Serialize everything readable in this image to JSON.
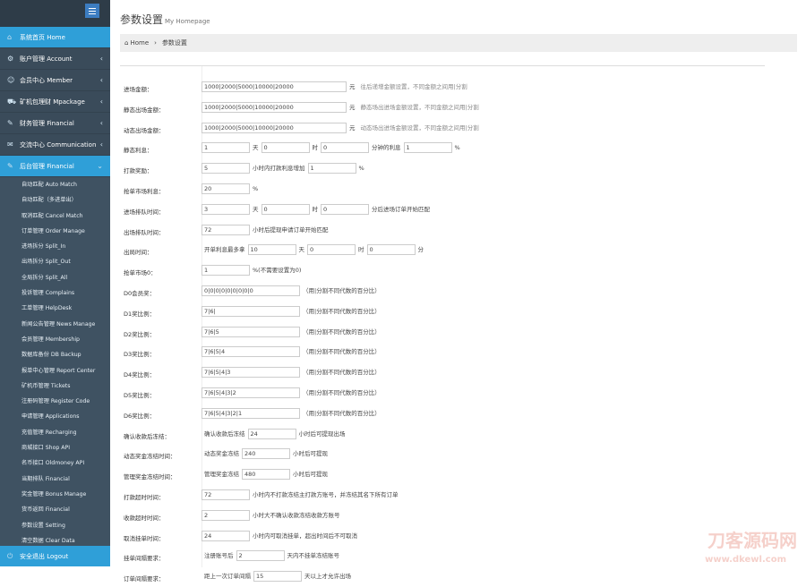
{
  "sidebar": {
    "items": [
      {
        "label": "系统首页 Home",
        "icon": "home-icon",
        "state": "active",
        "chev": ""
      },
      {
        "label": "账户管理 Account",
        "icon": "gear-icon",
        "state": "",
        "chev": "‹"
      },
      {
        "label": "会员中心 Member",
        "icon": "user-icon",
        "state": "",
        "chev": "‹"
      },
      {
        "label": "矿机包理财 Mpackage",
        "icon": "cart-icon",
        "state": "",
        "chev": "‹"
      },
      {
        "label": "财务管理 Financial",
        "icon": "tag-icon",
        "state": "",
        "chev": "‹"
      },
      {
        "label": "交流中心 Communication",
        "icon": "chat-icon",
        "state": "",
        "chev": "‹"
      },
      {
        "label": "后台管理 Financial",
        "icon": "tag-icon",
        "state": "open",
        "chev": "⌄"
      }
    ],
    "subitems": [
      "自动匹配 Auto Match",
      "自动匹配（多进单出）",
      "取消匹配 Cancel Match",
      "订单管理 Order Manage",
      "进场拆分 Split_In",
      "出场拆分 Split_Out",
      "全局拆分 Split_All",
      "投诉管理 Complains",
      "工单管理 HelpDesk",
      "新闻公告管理 News Manage",
      "会员管理 Membership",
      "数据库备份 DB Backup",
      "报单中心管理 Report Center",
      "矿机币管理 Tickets",
      "注册码管理 Register Code",
      "申请管理 Applications",
      "充值管理 Recharging",
      "商城接口 Shop API",
      "名币接口 Oldmoney API",
      "当期排队 Financial",
      "奖金管理 Bonus Manage",
      "货币返回 Financial",
      "参数设置 Setting",
      "清空数据 Clear Data"
    ],
    "logout": "安全退出 Logout"
  },
  "header": {
    "title": "参数设置",
    "subtitle": "My Homepage"
  },
  "breadcrumb": {
    "home": "Home",
    "sep": "›",
    "current": "参数设置"
  },
  "watermark": {
    "main": "刀客源码网",
    "url": "www.dkewl.com"
  },
  "form": {
    "rows": [
      {
        "label": "进场金额：",
        "parts": [
          {
            "t": "inp",
            "v": "1000|2000|5000|10000|20000",
            "w": 156
          },
          {
            "t": "txt",
            "v": "元"
          },
          {
            "t": "note",
            "v": "往后递增金额设置，不同金额之间用|分割"
          }
        ]
      },
      {
        "label": "静态出场金额：",
        "parts": [
          {
            "t": "inp",
            "v": "1000|2000|5000|10000|20000",
            "w": 156
          },
          {
            "t": "txt",
            "v": "元"
          },
          {
            "t": "note",
            "v": "静态场出进场金额设置，不同金额之间用|分割"
          }
        ]
      },
      {
        "label": "动态出场金额：",
        "parts": [
          {
            "t": "inp",
            "v": "1000|2000|5000|10000|20000",
            "w": 156
          },
          {
            "t": "txt",
            "v": "元"
          },
          {
            "t": "note",
            "v": "动态场出进场金额设置，不同金额之间用|分割"
          }
        ]
      },
      {
        "label": "静态利息：",
        "parts": [
          {
            "t": "inp",
            "v": "1",
            "w": 48
          },
          {
            "t": "txt",
            "v": "天"
          },
          {
            "t": "inp",
            "v": "0",
            "w": 48
          },
          {
            "t": "txt",
            "v": "时"
          },
          {
            "t": "inp",
            "v": "0",
            "w": 48
          },
          {
            "t": "txt",
            "v": "分钟的利息"
          },
          {
            "t": "inp",
            "v": "1",
            "w": 48
          },
          {
            "t": "txt",
            "v": "%"
          }
        ]
      },
      {
        "label": "打款奖励：",
        "parts": [
          {
            "t": "inp",
            "v": "5",
            "w": 48
          },
          {
            "t": "txt",
            "v": "小时内打款利息增加"
          },
          {
            "t": "inp",
            "v": "1",
            "w": 48
          },
          {
            "t": "txt",
            "v": "%"
          }
        ]
      },
      {
        "label": "抢单市场利息：",
        "parts": [
          {
            "t": "inp",
            "v": "20",
            "w": 48
          },
          {
            "t": "txt",
            "v": "%"
          }
        ]
      },
      {
        "label": "进场排队时间：",
        "parts": [
          {
            "t": "inp",
            "v": "3",
            "w": 48
          },
          {
            "t": "txt",
            "v": "天"
          },
          {
            "t": "inp",
            "v": "0",
            "w": 48
          },
          {
            "t": "txt",
            "v": "时"
          },
          {
            "t": "inp",
            "v": "0",
            "w": 48
          },
          {
            "t": "txt",
            "v": "分后进场订单开始匹配"
          }
        ]
      },
      {
        "label": "出场排队时间：",
        "parts": [
          {
            "t": "inp",
            "v": "72",
            "w": 48
          },
          {
            "t": "txt",
            "v": "小时后提现申请订单开始匹配"
          }
        ]
      },
      {
        "label": "出局时间：",
        "parts": [
          {
            "t": "txt",
            "v": "开单利息最多拿"
          },
          {
            "t": "inp",
            "v": "10",
            "w": 48
          },
          {
            "t": "txt",
            "v": "天"
          },
          {
            "t": "inp",
            "v": "0",
            "w": 48
          },
          {
            "t": "txt",
            "v": "时"
          },
          {
            "t": "inp",
            "v": "0",
            "w": 48
          },
          {
            "t": "txt",
            "v": "分"
          }
        ]
      },
      {
        "label": "抢单市场0：",
        "parts": [
          {
            "t": "inp",
            "v": "1",
            "w": 48
          },
          {
            "t": "txt",
            "v": "%(不需要设置为0)"
          }
        ]
      },
      {
        "label": "D0会员奖：",
        "parts": [
          {
            "t": "inp",
            "v": "0|0|0|0|0|0|0|0|0",
            "w": 104
          },
          {
            "t": "txt",
            "v": "（用|分割不同代数的百分比）"
          }
        ]
      },
      {
        "label": "D1奖比例：",
        "parts": [
          {
            "t": "inp",
            "v": "7|6|",
            "w": 104
          },
          {
            "t": "txt",
            "v": "（用|分割不同代数的百分比）"
          }
        ]
      },
      {
        "label": "D2奖比例：",
        "parts": [
          {
            "t": "inp",
            "v": "7|6|5",
            "w": 104
          },
          {
            "t": "txt",
            "v": "（用|分割不同代数的百分比）"
          }
        ]
      },
      {
        "label": "D3奖比例：",
        "parts": [
          {
            "t": "inp",
            "v": "7|6|5|4",
            "w": 104
          },
          {
            "t": "txt",
            "v": "（用|分割不同代数的百分比）"
          }
        ]
      },
      {
        "label": "D4奖比例：",
        "parts": [
          {
            "t": "inp",
            "v": "7|6|5|4|3",
            "w": 104
          },
          {
            "t": "txt",
            "v": "（用|分割不同代数的百分比）"
          }
        ]
      },
      {
        "label": "D5奖比例：",
        "parts": [
          {
            "t": "inp",
            "v": "7|6|5|4|3|2",
            "w": 104
          },
          {
            "t": "txt",
            "v": "（用|分割不同代数的百分比）"
          }
        ]
      },
      {
        "label": "D6奖比例：",
        "parts": [
          {
            "t": "inp",
            "v": "7|6|5|4|3|2|1",
            "w": 104
          },
          {
            "t": "txt",
            "v": "（用|分割不同代数的百分比）"
          }
        ]
      },
      {
        "label": "确认收款后冻结：",
        "parts": [
          {
            "t": "txt",
            "v": "确认收款后冻结"
          },
          {
            "t": "inp",
            "v": "24",
            "w": 48
          },
          {
            "t": "txt",
            "v": "小时后可提现出场"
          }
        ]
      },
      {
        "label": "动态奖金冻结时间：",
        "parts": [
          {
            "t": "txt",
            "v": "动态奖金冻结"
          },
          {
            "t": "inp",
            "v": "240",
            "w": 48
          },
          {
            "t": "txt",
            "v": "小时后可提现"
          }
        ]
      },
      {
        "label": "管理奖金冻结时间：",
        "parts": [
          {
            "t": "txt",
            "v": "管理奖金冻结"
          },
          {
            "t": "inp",
            "v": "480",
            "w": 48
          },
          {
            "t": "txt",
            "v": "小时后可提现"
          }
        ]
      },
      {
        "label": "打款超时时间：",
        "parts": [
          {
            "t": "inp",
            "v": "72",
            "w": 48
          },
          {
            "t": "txt",
            "v": "小时内不打款冻结主打款方账号，并冻结其名下所有订单"
          }
        ]
      },
      {
        "label": "收款超时时间：",
        "parts": [
          {
            "t": "inp",
            "v": "2",
            "w": 48
          },
          {
            "t": "txt",
            "v": "小时大不确认收款冻结收款方账号"
          }
        ]
      },
      {
        "label": "取消挂单时间：",
        "parts": [
          {
            "t": "inp",
            "v": "24",
            "w": 48
          },
          {
            "t": "txt",
            "v": "小时内可取消挂单，超出时间后不可取消"
          }
        ]
      },
      {
        "label": "挂单间隔要求：",
        "parts": [
          {
            "t": "txt",
            "v": "注册账号后"
          },
          {
            "t": "inp",
            "v": "2",
            "w": 48
          },
          {
            "t": "txt",
            "v": "天内不挂单冻结账号"
          }
        ]
      },
      {
        "label": "订单间隔要求：",
        "parts": [
          {
            "t": "txt",
            "v": "距上一次订单间隔"
          },
          {
            "t": "inp",
            "v": "15",
            "w": 48
          },
          {
            "t": "txt",
            "v": "天以上才允许出场"
          }
        ]
      }
    ]
  }
}
